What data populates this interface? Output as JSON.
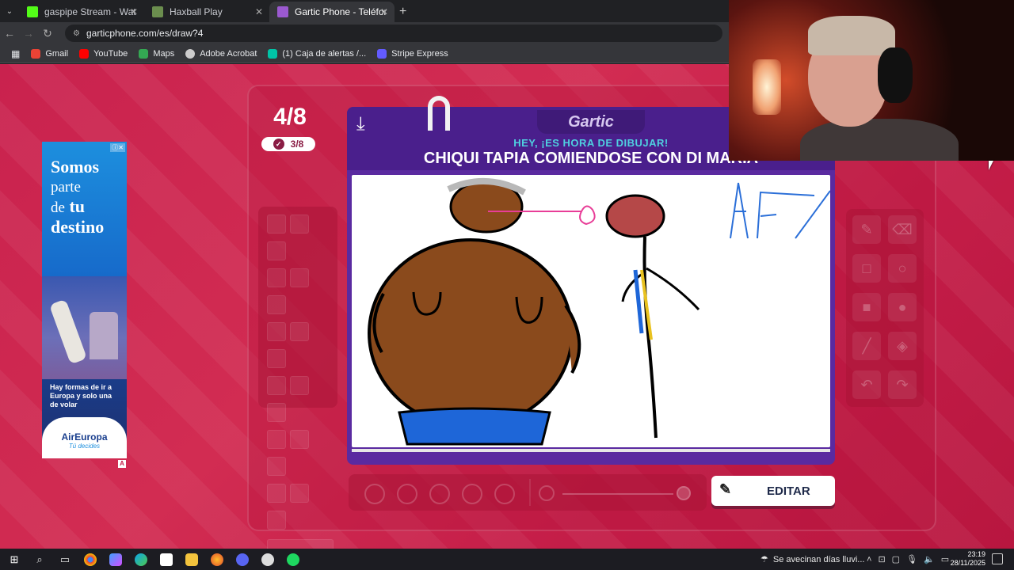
{
  "browser": {
    "tabs": [
      {
        "title": "gaspipe Stream - Watch Live on",
        "favicon_color": "#53fc18",
        "active": false
      },
      {
        "title": "Haxball Play",
        "favicon_color": "#6b8e4e",
        "active": false
      },
      {
        "title": "Gartic Phone - Teléfono Descon",
        "favicon_color": "#9b59d0",
        "active": true
      }
    ],
    "new_tab": "+",
    "url": "garticphone.com/es/draw?4",
    "bookmarks": [
      {
        "label": "Gmail",
        "color": "#ea4335"
      },
      {
        "label": "YouTube",
        "color": "#ff0000"
      },
      {
        "label": "Maps",
        "color": "#34a853"
      },
      {
        "label": "Adobe Acrobat",
        "color": "#cccccc"
      },
      {
        "label": "(1) Caja de alertas /...",
        "color": "#00c4a7"
      },
      {
        "label": "Stripe Express",
        "color": "#635bff"
      }
    ]
  },
  "game": {
    "round": "4/8",
    "done_count": "3/8",
    "logo": "Gartic",
    "prompt_header": "HEY, ¡ES HORA DE DIBUJAR!",
    "prompt": "CHIQUI TAPIA COMIENDOSE CON DI MARIA",
    "edit_button": "EDITAR",
    "accent_color": "#5a2aa0",
    "background_color": "#c9224e"
  },
  "ad": {
    "headline_1": "Somos",
    "headline_2": "parte",
    "headline_3": "de",
    "headline_4": "tu",
    "headline_5": "destino",
    "body": "Hay formas de ir a Europa y solo una de volar",
    "brand": "AirEuropa",
    "tagline": "Tú decides",
    "flag": "A"
  },
  "taskbar": {
    "weather": "Se avecinan días lluvi...",
    "time": "23:19",
    "date": "28/11/2025"
  }
}
